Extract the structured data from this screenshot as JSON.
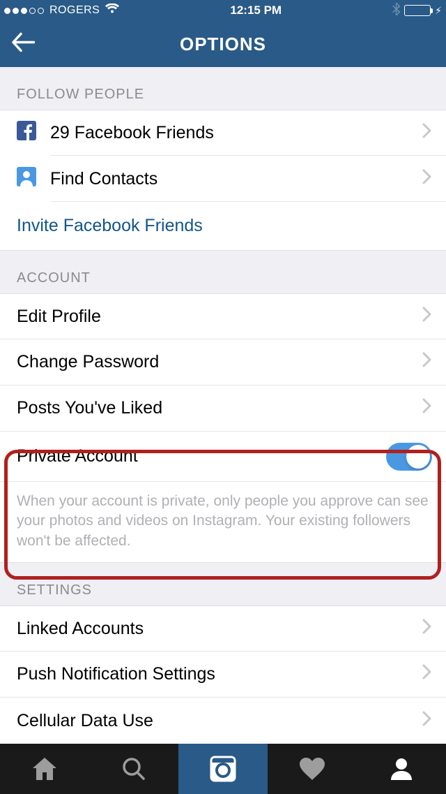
{
  "status": {
    "carrier": "ROGERS",
    "time": "12:15 PM"
  },
  "header": {
    "title": "OPTIONS"
  },
  "sections": {
    "follow": {
      "header": "FOLLOW PEOPLE",
      "facebook_friends": "29 Facebook Friends",
      "find_contacts": "Find Contacts",
      "invite": "Invite Facebook Friends"
    },
    "account": {
      "header": "ACCOUNT",
      "edit_profile": "Edit Profile",
      "change_password": "Change Password",
      "posts_liked": "Posts You've Liked",
      "private_account": "Private Account",
      "private_desc": "When your account is private, only people you approve can see your photos and videos on Instagram. Your existing followers won't be affected."
    },
    "settings": {
      "header": "SETTINGS",
      "linked_accounts": "Linked Accounts",
      "push_notifications": "Push Notification Settings",
      "cellular": "Cellular Data Use"
    }
  }
}
